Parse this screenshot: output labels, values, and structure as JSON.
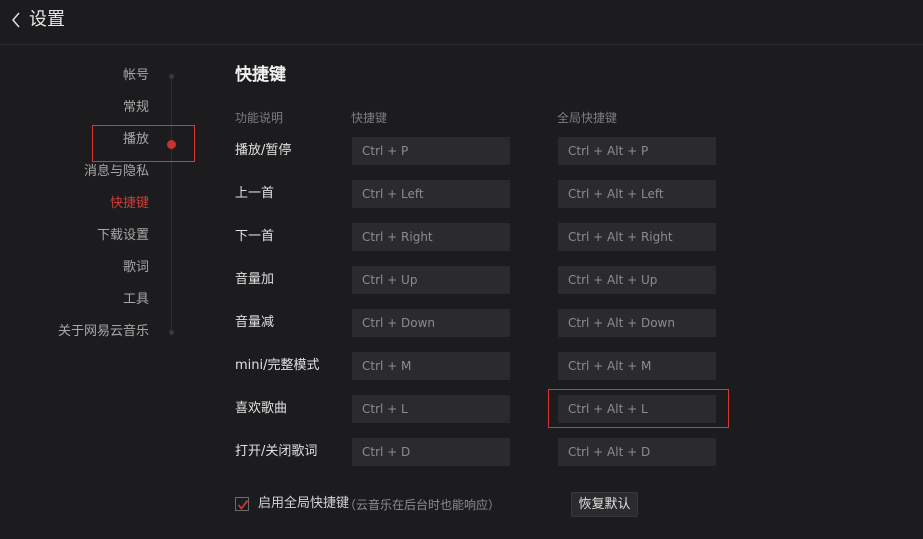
{
  "header": {
    "title": "设置"
  },
  "nav": {
    "items": [
      {
        "label": "帐号"
      },
      {
        "label": "常规"
      },
      {
        "label": "播放"
      },
      {
        "label": "消息与隐私"
      },
      {
        "label": "快捷键"
      },
      {
        "label": "下载设置"
      },
      {
        "label": "歌词"
      },
      {
        "label": "工具"
      },
      {
        "label": "关于网易云音乐"
      }
    ],
    "active_index": 4
  },
  "section": {
    "title": "快捷键",
    "columns": {
      "function": "功能说明",
      "shortcut": "快捷键",
      "global": "全局快捷键"
    },
    "rows": [
      {
        "label": "播放/暂停",
        "shortcut": "Ctrl + P",
        "global": "Ctrl + Alt + P"
      },
      {
        "label": "上一首",
        "shortcut": "Ctrl + Left",
        "global": "Ctrl + Alt + Left"
      },
      {
        "label": "下一首",
        "shortcut": "Ctrl + Right",
        "global": "Ctrl + Alt + Right"
      },
      {
        "label": "音量加",
        "shortcut": "Ctrl + Up",
        "global": "Ctrl + Alt + Up"
      },
      {
        "label": "音量减",
        "shortcut": "Ctrl + Down",
        "global": "Ctrl + Alt + Down"
      },
      {
        "label": "mini/完整模式",
        "shortcut": "Ctrl + M",
        "global": "Ctrl + Alt + M"
      },
      {
        "label": "喜欢歌曲",
        "shortcut": "Ctrl + L",
        "global": "Ctrl + Alt + L"
      },
      {
        "label": "打开/关闭歌词",
        "shortcut": "Ctrl + D",
        "global": "Ctrl + Alt + D"
      }
    ]
  },
  "footer": {
    "enable_global_label": "启用全局快捷键",
    "enable_global_note": "（云音乐在后台时也能响应）",
    "enable_global_checked": true,
    "restore_default_label": "恢复默认"
  },
  "colors": {
    "accent": "#d83a32",
    "background": "#1c1c1f",
    "field": "#2b2b2e"
  }
}
